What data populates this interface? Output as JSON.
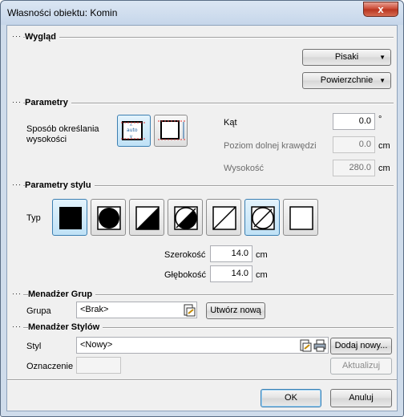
{
  "window": {
    "title": "Własności obiektu: Komin",
    "close_glyph": "x"
  },
  "sections": {
    "appearance": "Wygląd",
    "parameters": "Parametry",
    "style_parameters": "Parametry stylu",
    "group_manager": "Menadżer Grup",
    "style_manager": "Menadżer Stylów"
  },
  "appearance": {
    "pens_label": "Pisaki",
    "surfaces_label": "Powierzchnie"
  },
  "parameters": {
    "height_method_label_line1": "Sposób określania",
    "height_method_label_line2": "wysokości",
    "height_auto_text": "auto",
    "angle_label": "Kąt",
    "angle_value": "0.0",
    "angle_unit": "°",
    "bottom_level_label": "Poziom dolnej krawędzi",
    "bottom_level_value": "0.0",
    "bottom_level_unit": "cm",
    "height_label": "Wysokość",
    "height_value": "280.0",
    "height_unit": "cm"
  },
  "style_params": {
    "type_label": "Typ",
    "types": [
      {
        "icon": "solid-square-icon",
        "selected": true
      },
      {
        "icon": "solid-circle-icon",
        "selected": false
      },
      {
        "icon": "half-diagonal-square-icon",
        "selected": false
      },
      {
        "icon": "half-diagonal-circle-icon",
        "selected": false
      },
      {
        "icon": "diagonal-square-icon",
        "selected": false
      },
      {
        "icon": "diagonal-circle-icon",
        "selected": true
      },
      {
        "icon": "empty-square-icon",
        "selected": false
      }
    ],
    "width_label": "Szerokość",
    "width_value": "14.0",
    "width_unit": "cm",
    "depth_label": "Głębokość",
    "depth_value": "14.0",
    "depth_unit": "cm"
  },
  "group": {
    "label": "Grupa",
    "value": "<Brak>",
    "create_label": "Utwórz nową"
  },
  "style": {
    "label": "Styl",
    "value": "<Nowy>",
    "add_label": "Dodaj nowy...",
    "designation_label": "Oznaczenie",
    "designation_value": "",
    "update_label": "Aktualizuj"
  },
  "footer": {
    "ok_label": "OK",
    "cancel_label": "Anuluj"
  },
  "colors": {
    "accent": "#3c7fb1",
    "selected_bg": "#bfe1f6",
    "close_red": "#c9452f"
  }
}
